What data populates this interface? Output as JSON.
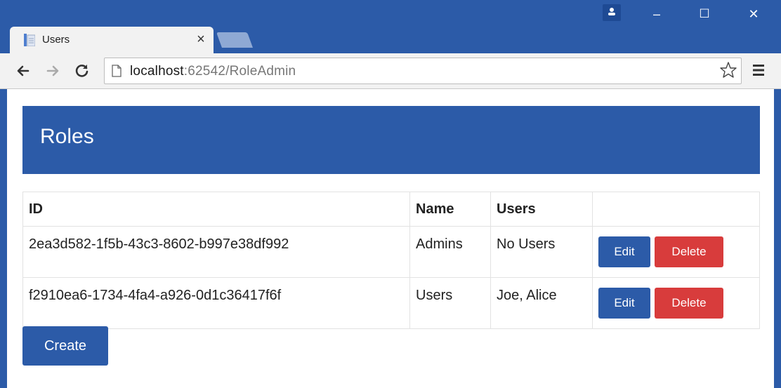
{
  "browser": {
    "tab_title": "Users",
    "tab_close_label": "×",
    "url_host": "localhost",
    "url_path": ":62542/RoleAdmin",
    "window_controls": {
      "minimize": "–",
      "maximize": "☐",
      "close": "✕"
    }
  },
  "page": {
    "heading": "Roles",
    "table": {
      "headers": [
        "ID",
        "Name",
        "Users",
        ""
      ],
      "rows": [
        {
          "id": "2ea3d582-1f5b-43c3-8602-b997e38df992",
          "name": "Admins",
          "users": "No Users",
          "edit_label": "Edit",
          "delete_label": "Delete"
        },
        {
          "id": "f2910ea6-1734-4fa4-a926-0d1c36417f6f",
          "name": "Users",
          "users": "Joe, Alice",
          "edit_label": "Edit",
          "delete_label": "Delete"
        }
      ]
    },
    "create_label": "Create"
  },
  "colors": {
    "primary": "#2c5ba8",
    "danger": "#d83c3c"
  },
  "icons": [
    "document-icon",
    "user-profile-icon",
    "back-arrow-icon",
    "forward-arrow-icon",
    "reload-icon",
    "page-icon",
    "star-icon",
    "menu-icon"
  ]
}
